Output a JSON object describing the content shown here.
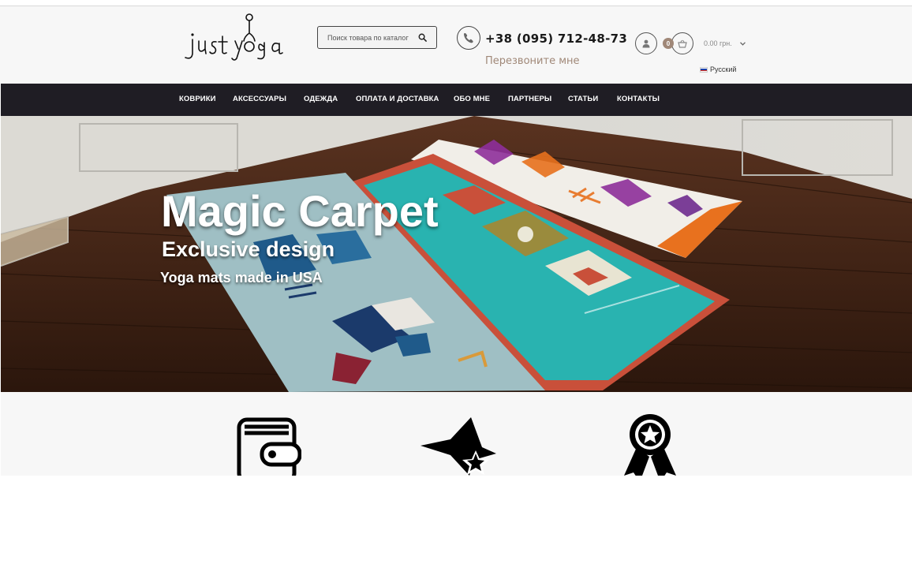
{
  "header": {
    "logo_text": "Just yoga",
    "search": {
      "placeholder": "Поиск товара по каталогу"
    },
    "phone": "+38 (095) 712-48-73",
    "callback_label": "Перезвоните мне",
    "cart": {
      "count": "0",
      "total": "0.00 грн."
    },
    "language": "Русский"
  },
  "nav": {
    "items": [
      {
        "label": "КОВРИКИ"
      },
      {
        "label": "АКСЕССУАРЫ"
      },
      {
        "label": "ОДЕЖДА"
      },
      {
        "label": "ОПЛАТА И ДОСТАВКА"
      },
      {
        "label": "ОБО МНЕ"
      },
      {
        "label": "ПАРТНЕРЫ"
      },
      {
        "label": "СТАТЬИ"
      },
      {
        "label": "КОНТАКТЫ"
      }
    ]
  },
  "hero": {
    "title": "Magic Carpet",
    "subtitle": "Exclusive design",
    "tagline": "Yoga mats made in USA"
  },
  "features": {
    "icons": [
      "wallet-icon",
      "star-swoosh-icon",
      "award-ribbon-icon"
    ]
  },
  "colors": {
    "nav_bg": "#1f1d24",
    "accent": "#a08878",
    "header_bg": "#f7f7f7"
  }
}
